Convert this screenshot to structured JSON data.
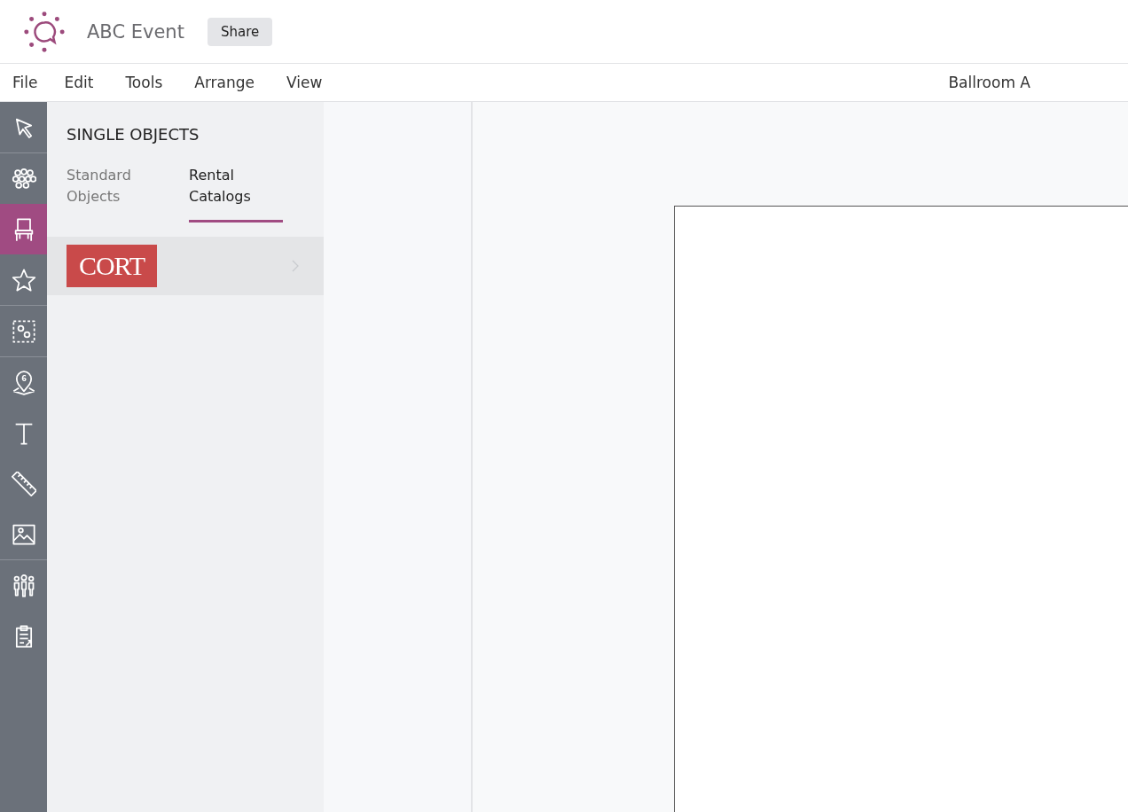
{
  "header": {
    "title": "ABC Event",
    "share": "Share"
  },
  "menu": [
    "File",
    "Edit",
    "Tools",
    "Arrange",
    "View"
  ],
  "room": "Ballroom A",
  "tools": [
    {
      "kind": "select",
      "selected": false,
      "divider_after": true
    },
    {
      "kind": "groups",
      "selected": false,
      "divider_after": false
    },
    {
      "kind": "chair",
      "selected": true,
      "divider_after": false
    },
    {
      "kind": "star",
      "selected": false,
      "divider_after": true
    },
    {
      "kind": "groupsettings",
      "selected": false,
      "divider_after": true
    },
    {
      "kind": "pin",
      "selected": false,
      "divider_after": false,
      "badge": "6"
    },
    {
      "kind": "text",
      "selected": false,
      "divider_after": false
    },
    {
      "kind": "ruler",
      "selected": false,
      "divider_after": false
    },
    {
      "kind": "image",
      "selected": false,
      "divider_after": true
    },
    {
      "kind": "people",
      "selected": false,
      "divider_after": false
    },
    {
      "kind": "clipboard",
      "selected": false,
      "divider_after": false
    }
  ],
  "panel": {
    "title": "SINGLE OBJECTS",
    "tabs": [
      {
        "label": "Standard Objects",
        "selected": false
      },
      {
        "label": "Rental Catalogs",
        "selected": true
      }
    ],
    "catalogs": [
      {
        "logo": "CORT",
        "highlighted": true
      }
    ]
  }
}
